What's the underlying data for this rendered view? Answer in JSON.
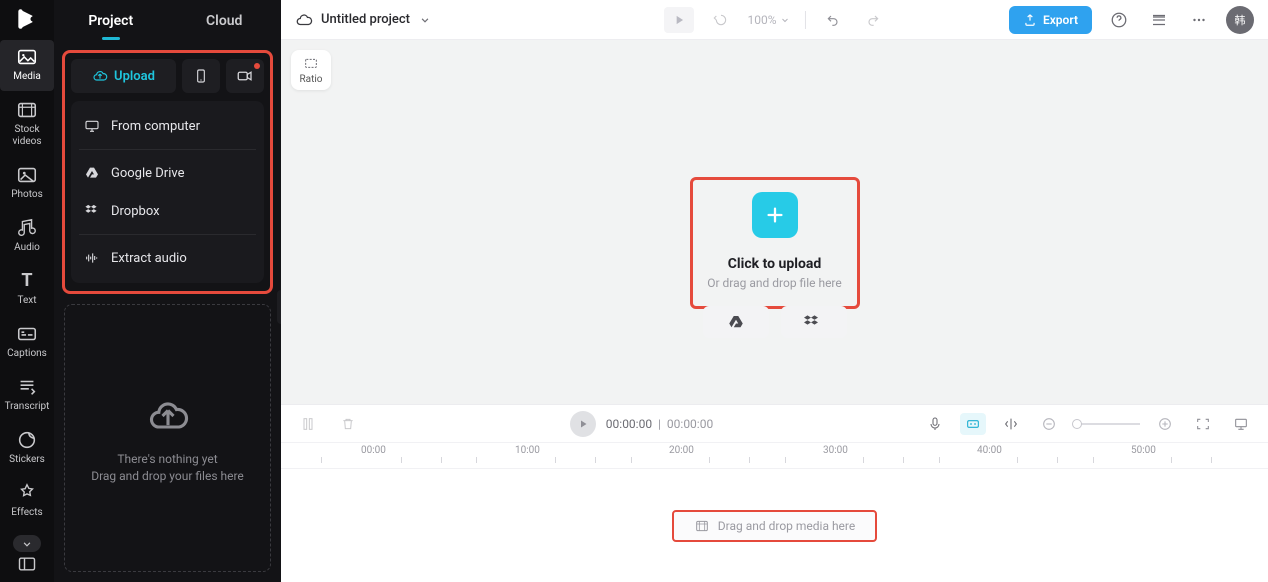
{
  "rail": {
    "items": [
      {
        "label": "Media"
      },
      {
        "label": "Stock\nvideos"
      },
      {
        "label": "Photos"
      },
      {
        "label": "Audio"
      },
      {
        "label": "Text"
      },
      {
        "label": "Captions"
      },
      {
        "label": "Transcript"
      },
      {
        "label": "Stickers"
      },
      {
        "label": "Effects"
      }
    ]
  },
  "side": {
    "tabs": {
      "project": "Project",
      "cloud": "Cloud"
    },
    "upload_label": "Upload",
    "menu": {
      "from_computer": "From computer",
      "google_drive": "Google Drive",
      "dropbox": "Dropbox",
      "extract_audio": "Extract audio"
    },
    "empty": {
      "line1": "There's nothing yet",
      "line2": "Drag and drop your files here"
    }
  },
  "header": {
    "title": "Untitled project",
    "zoom": "100%",
    "export": "Export"
  },
  "stage": {
    "ratio": "Ratio",
    "click_upload": "Click to upload",
    "drag_hint": "Or drag and drop file here"
  },
  "timeline": {
    "current": "00:00:00",
    "total": "00:00:00",
    "ticks": [
      "00:00",
      "10:00",
      "20:00",
      "30:00",
      "40:00",
      "50:00"
    ],
    "drop_label": "Drag and drop media here"
  },
  "colors": {
    "accent": "#1fc6de",
    "highlight": "#e54a3c",
    "export": "#2fa2ef"
  }
}
